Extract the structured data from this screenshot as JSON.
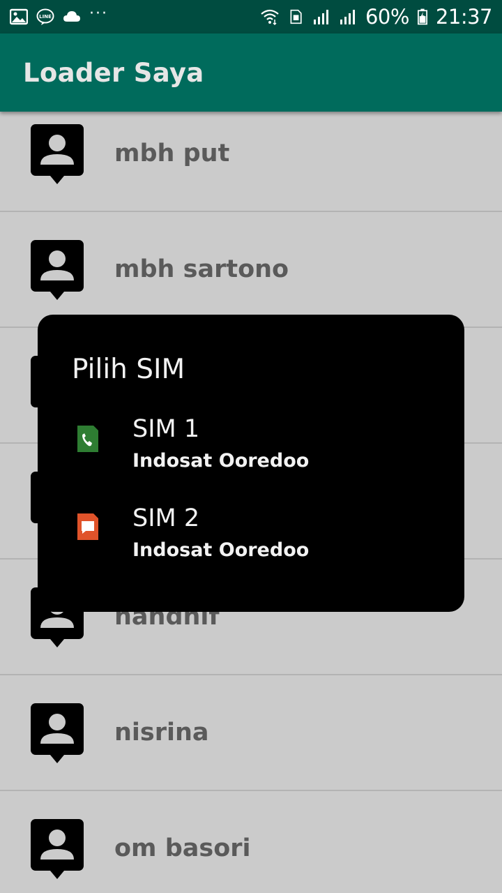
{
  "status_bar": {
    "battery": "60%",
    "time": "21:37",
    "icons": [
      "gallery-icon",
      "line-icon",
      "cloud-icon",
      "more-dots-icon",
      "wifi-icon",
      "sim-data-icon",
      "signal-icon",
      "signal-icon",
      "battery-icon"
    ]
  },
  "app_bar": {
    "title": "Loader Saya"
  },
  "contacts": [
    {
      "name": "mbh put"
    },
    {
      "name": "mbh sartono"
    },
    {
      "name": ""
    },
    {
      "name": ""
    },
    {
      "name": "nandhif"
    },
    {
      "name": "nisrina"
    },
    {
      "name": "om basori"
    }
  ],
  "dialog": {
    "title": "Pilih SIM",
    "options": [
      {
        "name": "SIM 1",
        "carrier": "Indosat Ooredoo",
        "icon": "phone-sim-icon",
        "color": "#2e7d32"
      },
      {
        "name": "SIM 2",
        "carrier": "Indosat Ooredoo",
        "icon": "message-sim-icon",
        "color": "#e0532a"
      }
    ]
  },
  "colors": {
    "status_bar": "#004c40",
    "app_bar": "#006b5c",
    "background": "#cbcbcb",
    "dialog": "#000000"
  }
}
